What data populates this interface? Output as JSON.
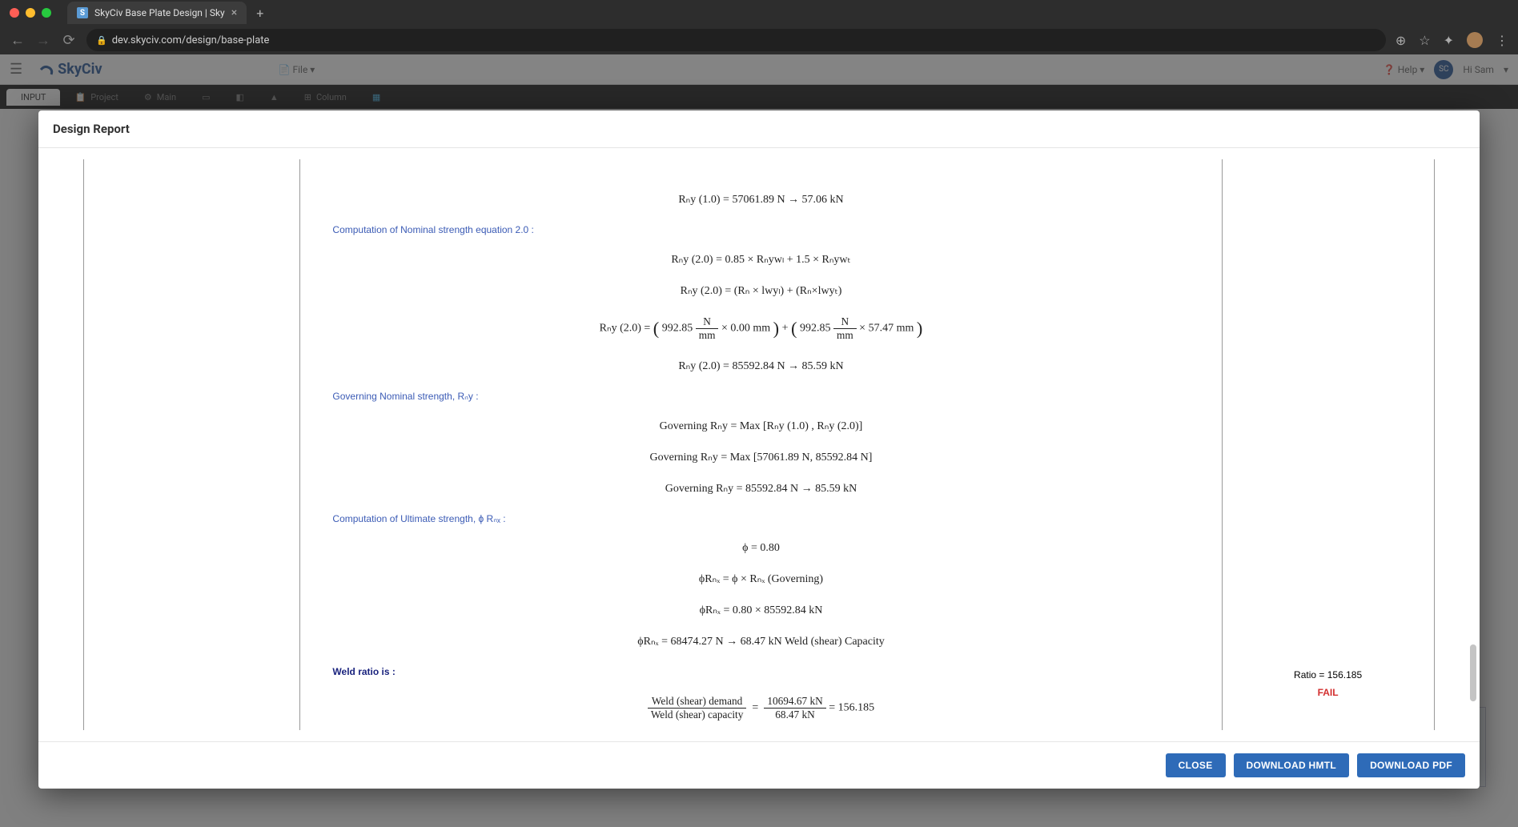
{
  "browser": {
    "tab_title": "SkyCiv Base Plate Design | Sky",
    "url": "dev.skyciv.com/design/base-plate"
  },
  "app": {
    "logo_text": "SkyCiv",
    "file_menu": "File",
    "help_label": "Help",
    "user_initials": "SC",
    "user_greeting": "Hi Sam",
    "tabs": {
      "input": "INPUT",
      "project": "Project",
      "main": "Main",
      "column": "Column"
    }
  },
  "modal": {
    "title": "Design Report",
    "buttons": {
      "close": "CLOSE",
      "download_html": "DOWNLOAD HMTL",
      "download_pdf": "DOWNLOAD PDF"
    }
  },
  "report": {
    "eq1": "Rₙy (1.0) = 57061.89 N → 57.06 kN",
    "heading_nom": "Computation of Nominal strength equation 2.0 :",
    "eq2": "Rₙy (2.0) = 0.85 × Rₙywₗ + 1.5 × Rₙywₜ",
    "eq3": "Rₙy (2.0) = (Rₙ × lwyₗ) + (Rₙ×lwyₜ)",
    "eq4_pre": "Rₙy (2.0) = ",
    "eq4_a_val": "992.85",
    "eq4_a_unit_num": "N",
    "eq4_a_unit_den": "mm",
    "eq4_a_mult": " × 0.00 mm",
    "eq4_plus": " + ",
    "eq4_b_val": "992.85",
    "eq4_b_unit_num": "N",
    "eq4_b_unit_den": "mm",
    "eq4_b_mult": " × 57.47 mm",
    "eq5": "Rₙy (2.0) = 85592.84 N → 85.59 kN",
    "heading_gov": "Governing Nominal strength, Rₙy :",
    "eq6": "Governing Rₙy = Max [Rₙy (1.0) , Rₙy (2.0)]",
    "eq7": "Governing Rₙy = Max [57061.89 N, 85592.84 N]",
    "eq8": "Governing Rₙy = 85592.84 N → 85.59 kN",
    "heading_ult": "Computation of Ultimate strength, ϕ Rₙₓ :",
    "eq9": "ϕ = 0.80",
    "eq10": "ϕRₙₓ = ϕ × Rₙₓ (Governing)",
    "eq11": "ϕRₙₓ = 0.80 × 85592.84 kN",
    "eq12": "ϕRₙₓ = 68474.27 N → 68.47 kN Weld (shear) Capacity",
    "heading_ratio": "Weld ratio is :",
    "frac_num_label": "Weld (shear) demand",
    "frac_den_label": "Weld (shear) capacity",
    "frac_num_val": "10694.67 kN",
    "frac_den_val": "68.47 kN",
    "frac_result": " = 156.185",
    "ratio_text": "Ratio = 156.185",
    "ratio_status": "FAIL"
  }
}
